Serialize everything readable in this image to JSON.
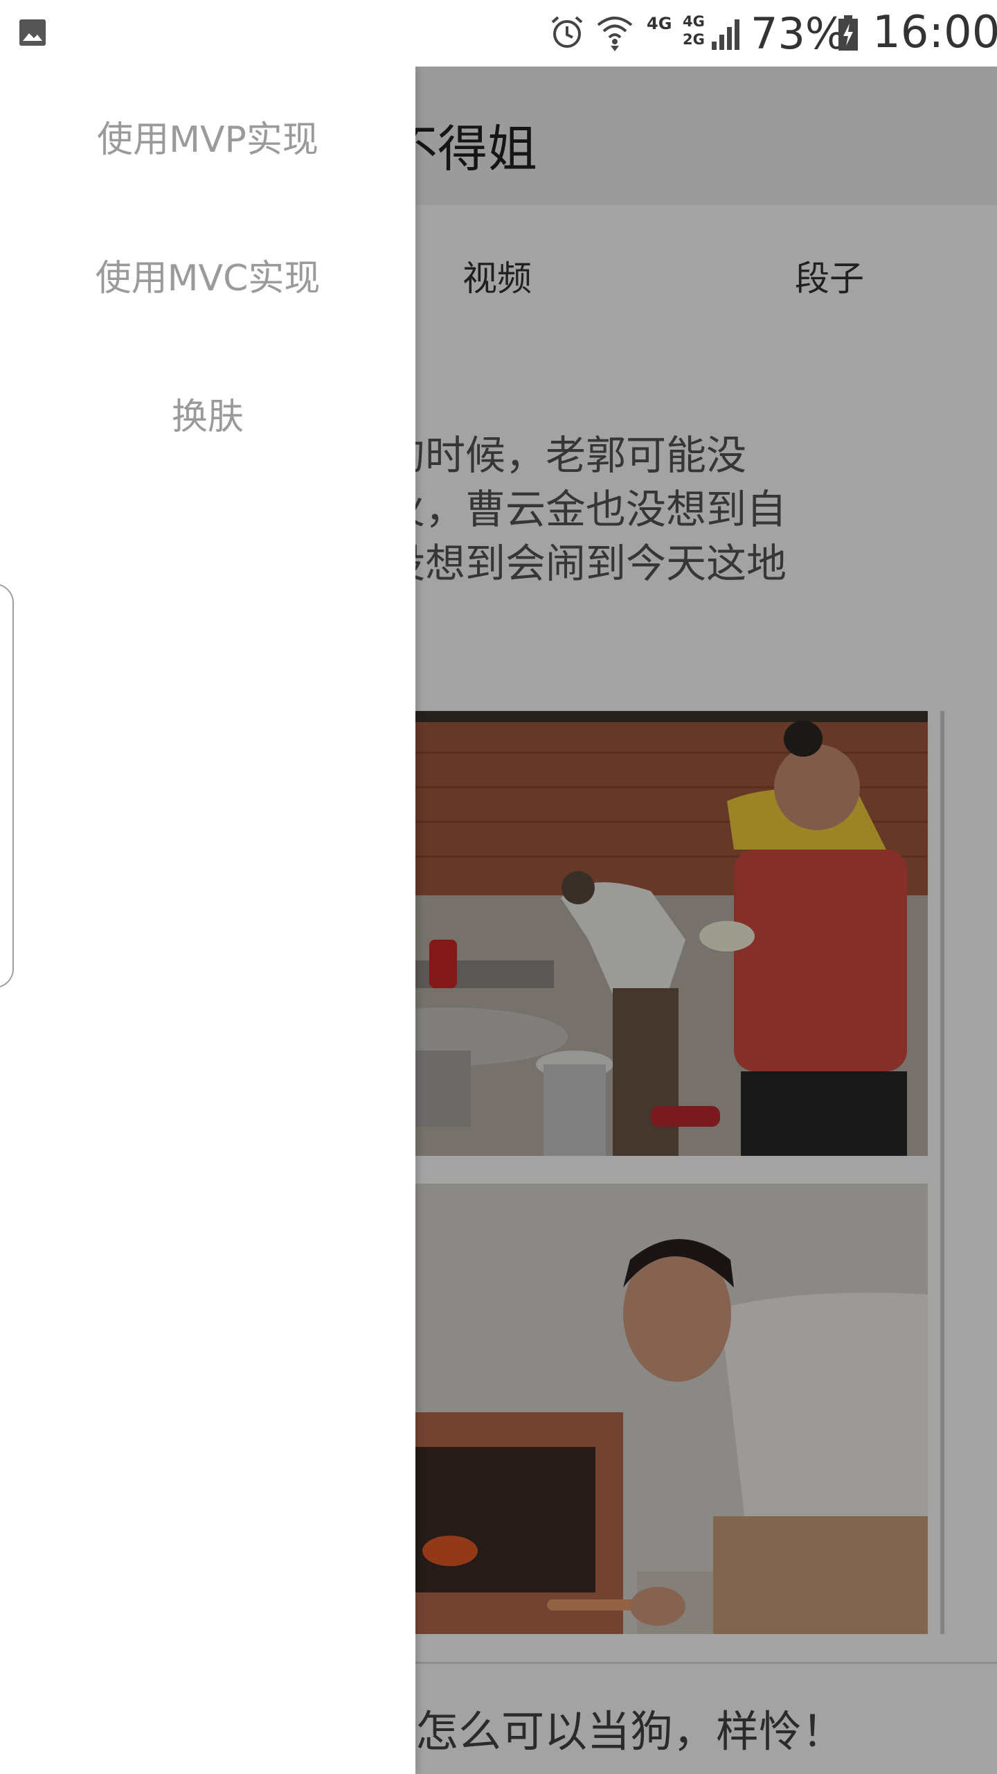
{
  "status_bar": {
    "gallery_icon": "image-icon",
    "alarm_icon": "alarm-clock-icon",
    "wifi_icon": "wifi-icon",
    "network_1": "4G",
    "network_2a": "4G",
    "network_2b": "2G",
    "signal_icon": "cellular-signal-icon",
    "battery_percent": "73%",
    "battery_icon": "battery-charging-icon",
    "time": "16:00"
  },
  "app_bar": {
    "title": "不得姐"
  },
  "tabs": [
    {
      "label": "视频"
    },
    {
      "label": "段子"
    }
  ],
  "post": {
    "text": "戏立的时候，老郭可能没\n这么火，曹云金也没想到自\n们都没想到会闹到今天这地",
    "next_post_text": "怎么可以当狗，样怜！"
  },
  "drawer": {
    "items": [
      {
        "label": "使用MVP实现"
      },
      {
        "label": "使用MVC实现"
      },
      {
        "label": "换肤"
      }
    ]
  },
  "colors": {
    "scrim": "#000000",
    "drawer_text": "#9a9a9a",
    "app_bar": "#f2f2f2"
  }
}
